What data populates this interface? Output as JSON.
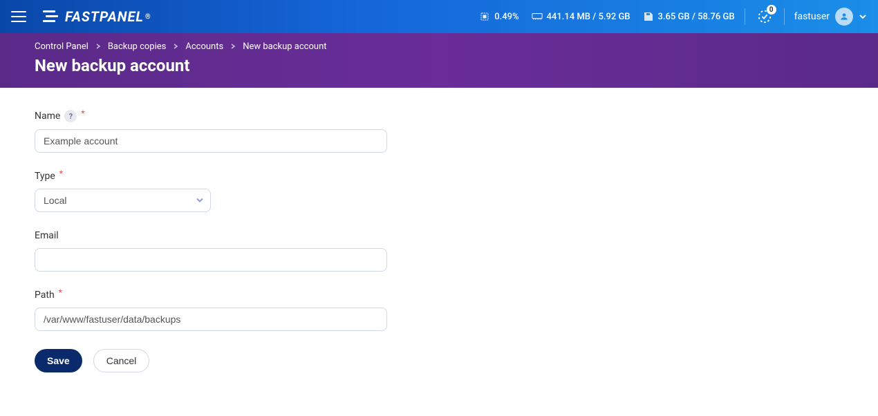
{
  "header": {
    "brand": "FASTPANEL",
    "cpu": "0.49%",
    "ram": "441.14 MB / 5.92 GB",
    "disk": "3.65 GB / 58.76 GB",
    "notif_count": "0",
    "username": "fastuser"
  },
  "breadcrumb": {
    "items": [
      "Control Panel",
      "Backup copies",
      "Accounts",
      "New backup account"
    ]
  },
  "page": {
    "title": "New backup account"
  },
  "form": {
    "name_label": "Name",
    "name_value": "Example account",
    "type_label": "Type",
    "type_value": "Local",
    "email_label": "Email",
    "email_value": "",
    "path_label": "Path",
    "path_value": "/var/www/fastuser/data/backups",
    "save": "Save",
    "cancel": "Cancel",
    "help_char": "?",
    "asterisk": "*"
  }
}
